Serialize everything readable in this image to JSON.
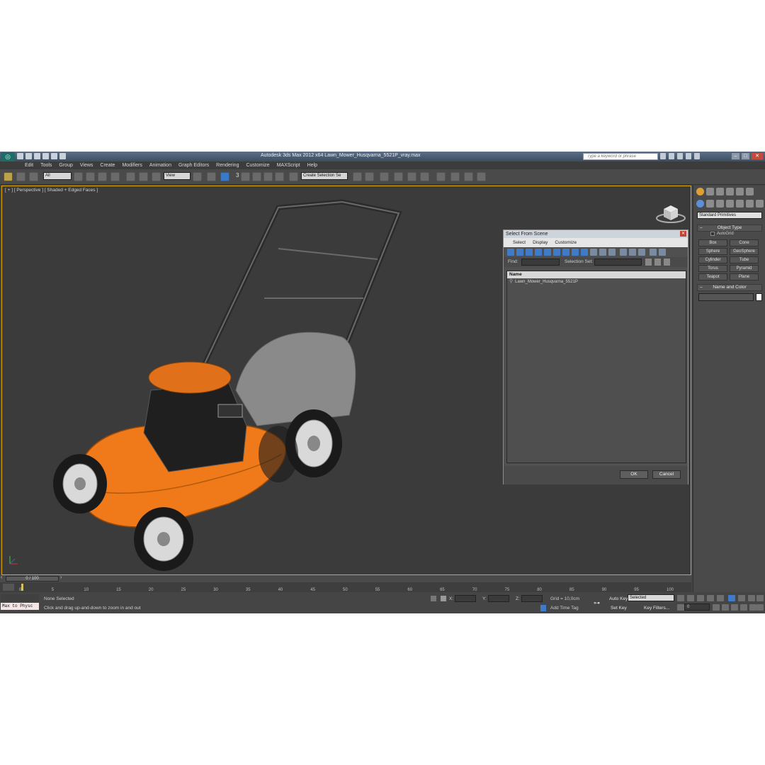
{
  "app": {
    "title": "Autodesk 3ds Max  2012 x64      Lawn_Mower_Husqvarna_5521P_vray.max",
    "search_placeholder": "Type a keyword or phrase"
  },
  "menu": [
    "Edit",
    "Tools",
    "Group",
    "Views",
    "Create",
    "Modifiers",
    "Animation",
    "Graph Editors",
    "Rendering",
    "Customize",
    "MAXScript",
    "Help"
  ],
  "toolbar": {
    "filter_dropdown": "All",
    "ref_coord_dropdown": "View",
    "selection_set_dropdown": "Create Selection Se",
    "snap_label": "3"
  },
  "viewport": {
    "label": "[ + ] [ Perspective ] [ Shaded + Edged Faces ]",
    "accent_color": "#e0a800",
    "mower_color": "#f07a1a"
  },
  "dialog": {
    "title": "Select From Scene",
    "menu": [
      "Select",
      "Display",
      "Customize"
    ],
    "find_label": "Find:",
    "selection_set_label": "Selection Set:",
    "column_header": "Name",
    "rows": [
      "Lawn_Mower_Husqvarna_5521P"
    ],
    "ok_label": "OK",
    "cancel_label": "Cancel"
  },
  "command_panel": {
    "category_dropdown": "Standard Primitives",
    "object_type_title": "Object Type",
    "autogrid_label": "AutoGrid",
    "primitives": [
      "Box",
      "Cone",
      "Sphere",
      "GeoSphere",
      "Cylinder",
      "Tube",
      "Torus",
      "Pyramid",
      "Teapot",
      "Plane"
    ],
    "name_color_title": "Name and Color"
  },
  "timeline": {
    "slider_label": "0 / 100",
    "ticks": [
      "0",
      "5",
      "10",
      "15",
      "20",
      "25",
      "30",
      "35",
      "40",
      "45",
      "50",
      "55",
      "60",
      "65",
      "70",
      "75",
      "80",
      "85",
      "90",
      "95",
      "100"
    ]
  },
  "status": {
    "maxscript_label": "Max to Physc",
    "selection_text": "None Selected",
    "hint_text": "Click and drag up-and-down to zoom in and out",
    "x_label": "X:",
    "y_label": "Y:",
    "z_label": "Z:",
    "grid_text": "Grid = 10,0cm",
    "add_time_tag": "Add Time Tag",
    "auto_key": "Auto Key",
    "set_key": "Set Key",
    "selected_dropdown": "Selected",
    "key_filters": "Key Filters...",
    "frame_value": "0"
  }
}
